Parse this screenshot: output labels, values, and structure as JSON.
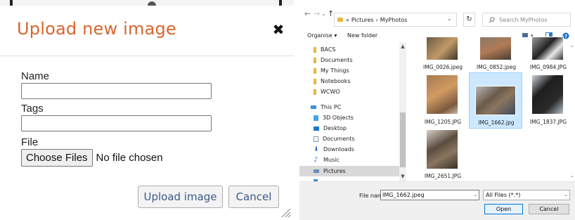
{
  "modal": {
    "title": "Upload new image",
    "close_glyph": "✖",
    "name_label": "Name",
    "name_value": "",
    "tags_label": "Tags",
    "tags_value": "",
    "file_label": "File",
    "choose_label": "Choose Files",
    "no_file_text": "No file chosen",
    "upload_label": "Upload image",
    "cancel_label": "Cancel",
    "accent_color": "#d9652b",
    "button_text_color": "#3a5a88"
  },
  "picker": {
    "breadcrumb": {
      "overflow": "«",
      "parent": "Pictures",
      "sep": "›",
      "current": "MyPhotos"
    },
    "search_placeholder": "Search MyPhotos",
    "toolbar": {
      "organise": "Organise ▾",
      "new_folder": "New folder"
    },
    "nav_items": [
      {
        "label": "BACS",
        "icon": "folder-icon"
      },
      {
        "label": "Documents",
        "icon": "folder-icon"
      },
      {
        "label": "My Things",
        "icon": "folder-icon"
      },
      {
        "label": "Notebooks",
        "icon": "folder-icon"
      },
      {
        "label": "WCWO",
        "icon": "folder-icon"
      },
      {
        "label": "This PC",
        "icon": "computer-icon"
      },
      {
        "label": "3D Objects",
        "icon": "cube-icon"
      },
      {
        "label": "Desktop",
        "icon": "desktop-icon"
      },
      {
        "label": "Documents",
        "icon": "document-icon"
      },
      {
        "label": "Downloads",
        "icon": "download-icon"
      },
      {
        "label": "Music",
        "icon": "music-icon"
      },
      {
        "label": "Pictures",
        "icon": "pictures-icon",
        "selected": true
      }
    ],
    "files": [
      {
        "name": "IMG_0026.jpeg"
      },
      {
        "name": "IMG_0852.jpeg"
      },
      {
        "name": "IMG_0984.JPG"
      },
      {
        "name": "IMG_1205.JPG"
      },
      {
        "name": "IMG_1662.jpg",
        "selected": true
      },
      {
        "name": "IMG_1837.JPG"
      },
      {
        "name": "IMG_2651.JPG"
      }
    ],
    "file_name_label": "File name:",
    "file_name_value": "IMG_1662.jpeg",
    "file_type_value": "All Files (*.*)",
    "open_label": "Open",
    "cancel_label": "Cancel",
    "selection_color": "#cce8ff"
  }
}
